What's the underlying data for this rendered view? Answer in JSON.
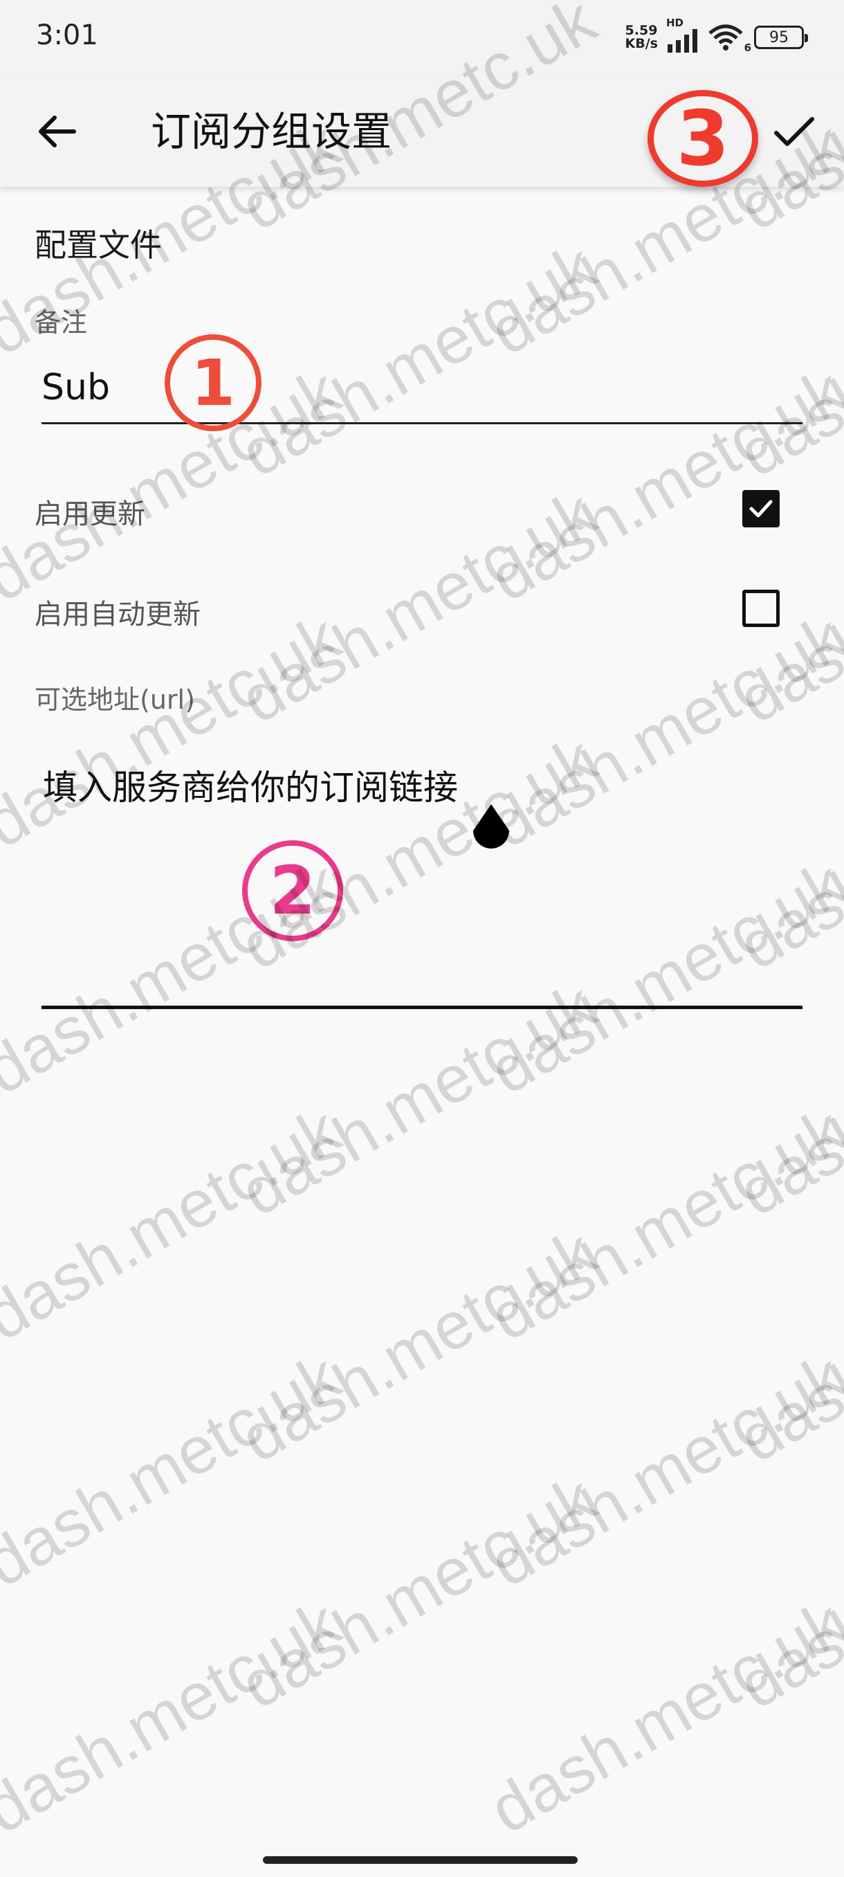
{
  "status_bar": {
    "time": "3:01",
    "net_speed_value": "5.59",
    "net_speed_unit": "KB/s",
    "network_type": "HD",
    "wifi_label": "6",
    "battery": "95"
  },
  "app_bar": {
    "title": "订阅分组设置",
    "back_icon": "arrow-back-icon",
    "confirm_icon": "check-icon"
  },
  "form": {
    "section_title": "配置文件",
    "remark": {
      "label": "备注",
      "value": "Sub"
    },
    "enable_update": {
      "label": "启用更新",
      "checked": true
    },
    "enable_auto_update": {
      "label": "启用自动更新",
      "checked": false
    },
    "url": {
      "label": "可选地址(url)",
      "placeholder": "填入服务商给你的订阅链接"
    }
  },
  "annotations": [
    {
      "id": "1",
      "color": "#ee4d3a"
    },
    {
      "id": "2",
      "color": "#e93b8b"
    },
    {
      "id": "3",
      "color": "#ee3b2e"
    }
  ],
  "watermark": "dash.metc.uk"
}
